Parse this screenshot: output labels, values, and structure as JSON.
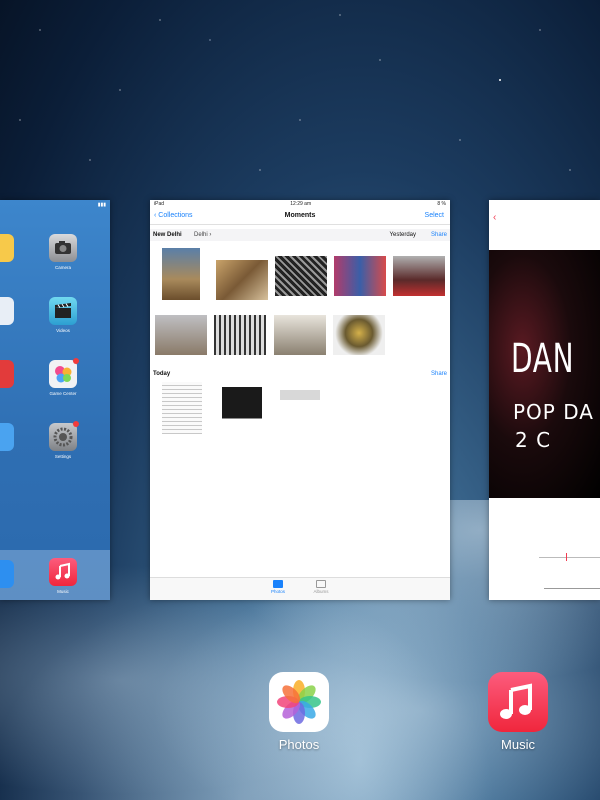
{
  "home_card": {
    "apps": [
      {
        "label": "Camera"
      },
      {
        "label": "Videos"
      },
      {
        "label": "Game Center"
      },
      {
        "label": "Settings"
      }
    ],
    "dock_label": "Music"
  },
  "photos_card": {
    "status": {
      "left": "iPad",
      "time": "12:29 am",
      "right": "8 %"
    },
    "nav": {
      "back": "Collections",
      "title": "Moments",
      "select": "Select"
    },
    "section1": {
      "location": "New Delhi",
      "sublocation": "Delhi",
      "date": "Yesterday",
      "share": "Share"
    },
    "section2": {
      "location": "Today",
      "share": "Share"
    },
    "tabs": [
      {
        "label": "Photos"
      },
      {
        "label": "Albums"
      }
    ]
  },
  "music_card": {
    "cover_lines": [
      "DAN",
      "POP DA",
      "2   C"
    ]
  },
  "bottom_apps": [
    {
      "label": "Photos"
    },
    {
      "label": "Music"
    }
  ]
}
